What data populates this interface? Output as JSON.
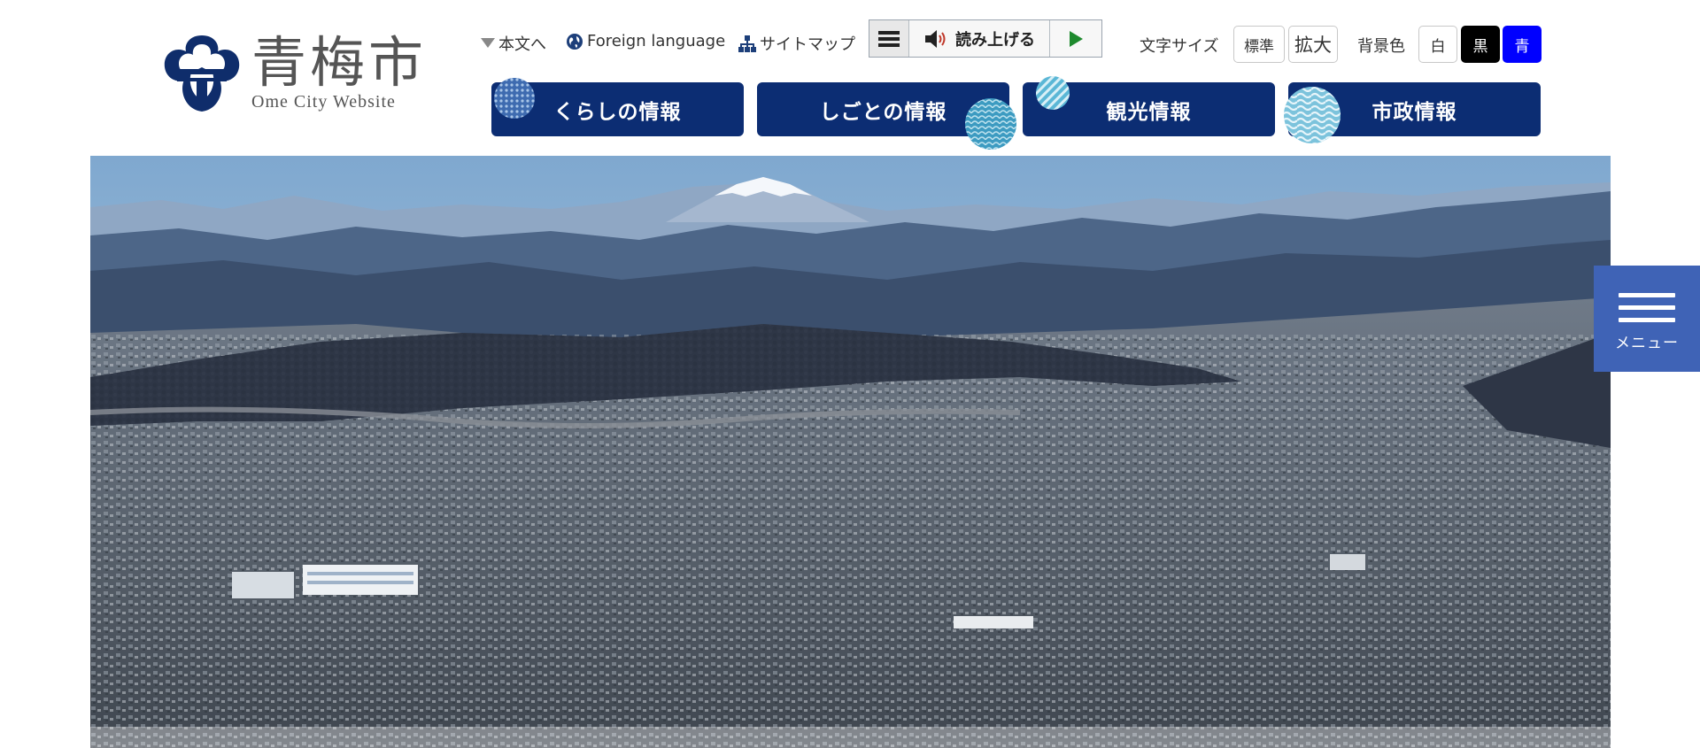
{
  "site": {
    "logo_jp": "青梅市",
    "logo_en": "Ome City Website"
  },
  "utility": {
    "skip_link": "本文へ",
    "foreign_language": "Foreign language",
    "sitemap": "サイトマップ"
  },
  "reader": {
    "menu_icon": "hamburger-icon",
    "read_label": "読み上げる",
    "speaker_icon": "speaker-icon",
    "play_icon": "play-icon"
  },
  "text_size": {
    "label": "文字サイズ",
    "standard": "標準",
    "enlarge": "拡大"
  },
  "bg_color": {
    "label": "背景色",
    "white": "白",
    "black": "黒",
    "blue": "青"
  },
  "nav": [
    {
      "label": "くらしの情報"
    },
    {
      "label": "しごとの情報"
    },
    {
      "label": "観光情報"
    },
    {
      "label": "市政情報"
    }
  ],
  "hero": {
    "alt_icon": "aerial-city-photo"
  },
  "side_menu": {
    "label": "メニュー"
  },
  "colors": {
    "nav_bg": "#0c2d73",
    "side_menu_bg": "#3f63b6",
    "bg_black": "#000000",
    "bg_blue": "#0000ff",
    "accent_light": "#7cc3dc"
  }
}
